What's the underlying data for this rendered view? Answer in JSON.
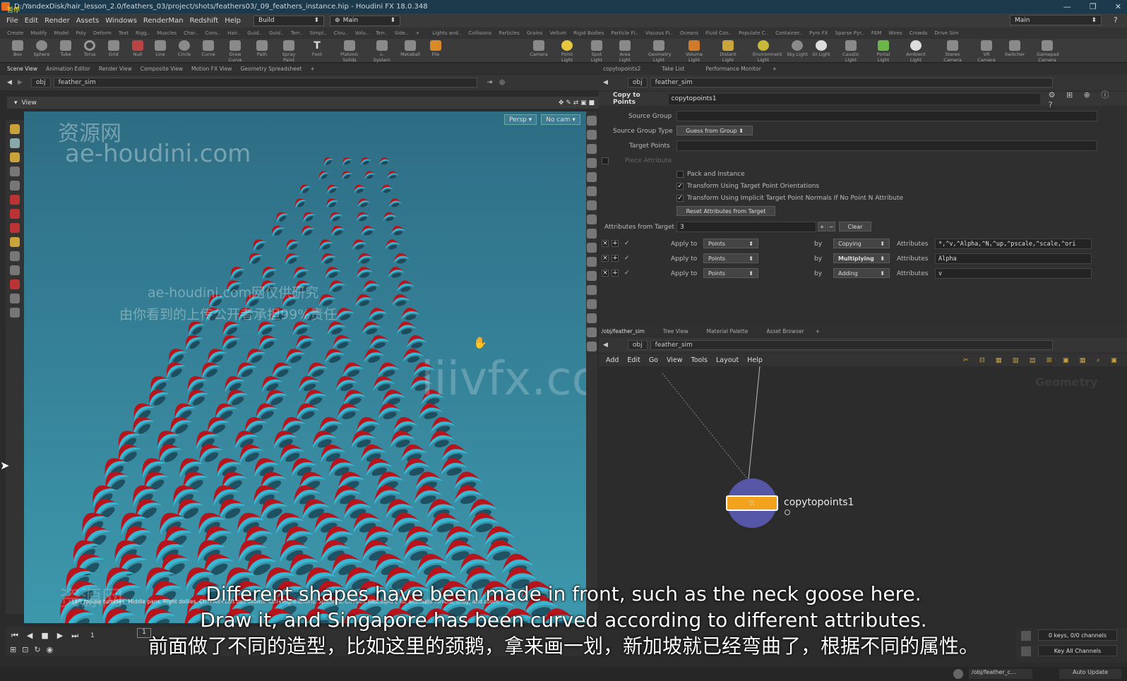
{
  "window": {
    "title": "D:/YandexDisk/hair_lesson_2.0/feathers_03/project/shots/feathers03/_09_feathers_instance.hip - Houdini FX 18.0.348",
    "badge": "暂停",
    "controls": [
      "—",
      "❐",
      "✕"
    ]
  },
  "menu": {
    "items": [
      "File",
      "Edit",
      "Render",
      "Assets",
      "Windows",
      "RenderMan",
      "Redshift",
      "Help"
    ],
    "desktop": "Build",
    "context": "Main",
    "right_desktop": "Main"
  },
  "shelf": {
    "left_tabs": [
      "Create",
      "Modify",
      "Model",
      "Poly",
      "Deform",
      "Text",
      "Rigg..",
      "Muscles",
      "Char..",
      "Cons..",
      "Hair..",
      "Guid..",
      "Guid..",
      "Terr..",
      "Simpl..",
      "Clou..",
      "Volu..",
      "Terr..",
      "Side.."
    ],
    "right_tabs": [
      "Lights and..",
      "Collisions",
      "Particles",
      "Grains",
      "Vellum",
      "Rigid Bodies",
      "Particle Fl..",
      "Viscous Fl..",
      "Oceans",
      "Fluid Con..",
      "Populate C..",
      "Container..",
      "Pyro FX",
      "Sparse Pyr..",
      "FEM",
      "Wires",
      "Crowds",
      "Drive Sim"
    ],
    "left_tools": [
      "Box",
      "Sphere",
      "Tube",
      "Torus",
      "Grid",
      "Null",
      "Line",
      "Circle",
      "Curve",
      "Draw Curve",
      "Path",
      "Spray Paint",
      "Font",
      "Platonic Solids",
      "L-System",
      "Metaball",
      "File"
    ],
    "right_tools": [
      "Camera",
      "Point Light",
      "Spot Light",
      "Area Light",
      "Geometry Light",
      "Volume Light",
      "Distant Light",
      "Environment Light",
      "Sky Light",
      "GI Light",
      "Caustic Light",
      "Portal Light",
      "Ambient Light",
      "Stereo Camera",
      "VR Camera",
      "Switcher",
      "Gamepad Camera"
    ]
  },
  "left_pane": {
    "tabs": [
      "Scene View",
      "Animation Editor",
      "Render View",
      "Composite View",
      "Motion FX View",
      "Geometry Spreadsheet"
    ],
    "path": [
      "obj",
      "feather_sim"
    ],
    "view_label": "View",
    "persp": "Persp ▾",
    "cam": "No cam ▾",
    "hint": "Left mouse tumbles. Middle pans. Right dollies. Ctrl+Alt+Left box-zooms. Ctrl+Right zooms. Spacebar-Ctrl-Left tilts. Hold L for alternate tumble, dolly, and zoom."
  },
  "watermarks": {
    "site_cn": "资源网",
    "site": "ae-houdini.com",
    "notice_1": "ae-houdini.com网仅供研究",
    "notice_2": "由你看到的上传公开者承担99%责任",
    "iiivfx": "iiivfx.com",
    "bottom_cn": "资源网",
    "bottom_site": "ae-houdini.com"
  },
  "parm_pane": {
    "tabs": [
      "copytopoints2",
      "Take List",
      "Performance Monitor"
    ],
    "path": [
      "obj",
      "feather_sim"
    ],
    "node_type": "Copy to Points",
    "node_name": "copytopoints1",
    "source_group_label": "Source Group",
    "source_group_type_label": "Source Group Type",
    "source_group_type_value": "Guess from Group",
    "target_points_label": "Target Points",
    "piece_attr_label": "Piece Attribute",
    "pack_label": "Pack and Instance",
    "orient_label": "Transform Using Target Point Orientations",
    "implicit_label": "Transform Using Implicit Target Point Normals If No Point N Attribute",
    "reset_button": "Reset Attributes from Target",
    "attrs_from_target_label": "Attributes from Target",
    "attrs_count": "3",
    "clear_button": "Clear",
    "rows": [
      {
        "apply_label": "Apply to",
        "apply_value": "Points",
        "by": "by",
        "method": "Copying",
        "attr_label": "Attributes",
        "attr_value": "*,^v,^Alpha,^N,^up,^pscale,^scale,^ori"
      },
      {
        "apply_label": "Apply to",
        "apply_value": "Points",
        "by": "by",
        "method": "Multiplying",
        "attr_label": "Attributes",
        "attr_value": "Alpha"
      },
      {
        "apply_label": "Apply to",
        "apply_value": "Points",
        "by": "by",
        "method": "Adding",
        "attr_label": "Attributes",
        "attr_value": "v"
      }
    ]
  },
  "net_pane": {
    "tabs": [
      "/obj/feather_sim",
      "Tree View",
      "Material Palette",
      "Asset Browser"
    ],
    "path": [
      "obj",
      "feather_sim"
    ],
    "menu": [
      "Add",
      "Edit",
      "Go",
      "View",
      "Tools",
      "Layout",
      "Help"
    ],
    "context_label": "Geometry",
    "node_label": "copytopoints1"
  },
  "subtitles": {
    "line1": "Different shapes have been made in front, such as the neck goose here.",
    "line2": "Draw it, and Singapore has been curved according to different attributes.",
    "line3": "前面做了不同的造型，比如这里的颈鹅，拿来画一划，新加坡就已经弯曲了，根据不同的属性。"
  },
  "timeline": {
    "frame": "1",
    "frame_box": "1",
    "keys": "0 keys, 0/0 channels",
    "key_all": "Key All Channels"
  },
  "status": {
    "path": "/obj/feather_c...",
    "update": "Auto Update"
  },
  "colors": {
    "viewport_top": "#2f6f86",
    "viewport_bottom": "#3b96ab",
    "feather_red": "#b8141c",
    "feather_cyan": "#39b7d2",
    "node_ring": "#5a5ab8",
    "node_bar": "#f3a21d"
  }
}
